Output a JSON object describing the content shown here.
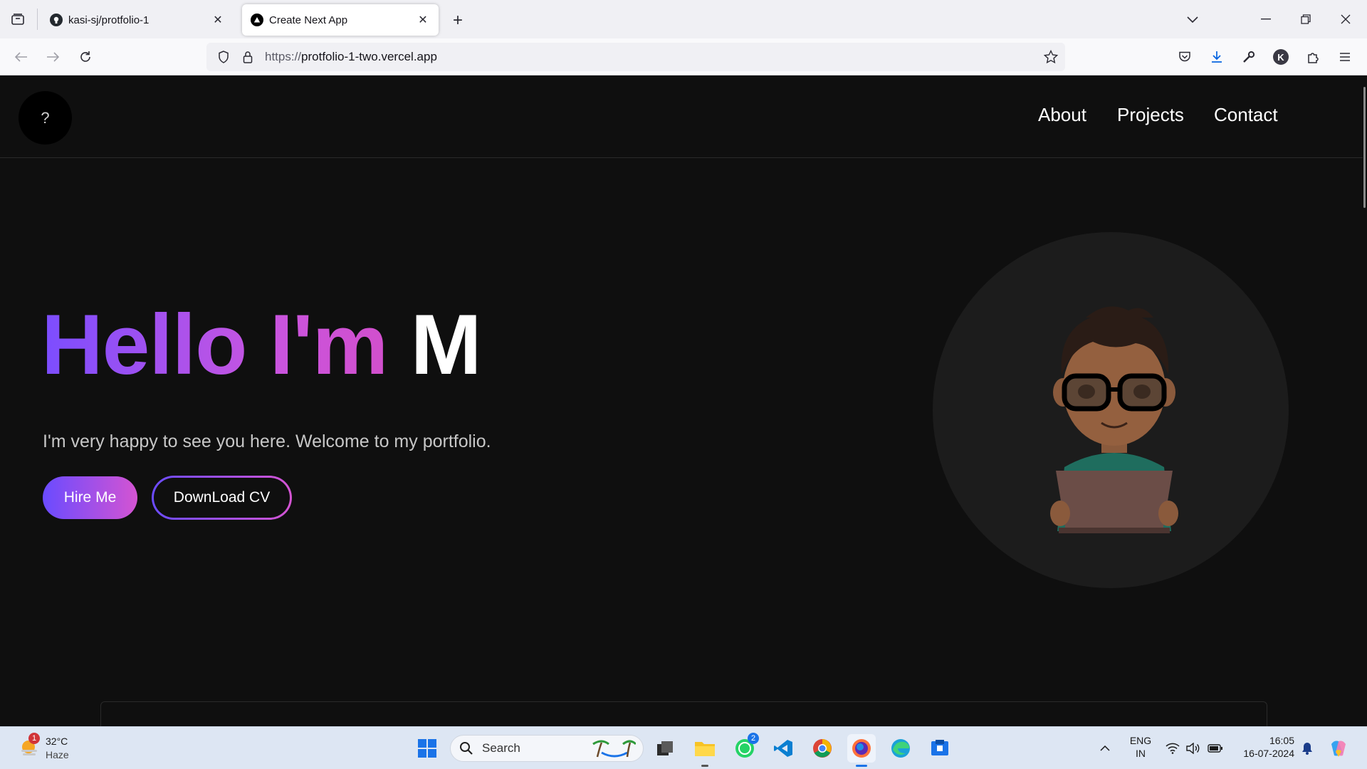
{
  "browser": {
    "tabs": [
      {
        "title": "kasi-sj/protfolio-1",
        "icon": "github-icon",
        "active": false
      },
      {
        "title": "Create Next App",
        "icon": "vercel-icon",
        "active": true
      }
    ],
    "url_scheme": "https://",
    "url_host": "protfolio-1-two.vercel.app",
    "toolbar_icons": [
      "back-icon",
      "forward-icon",
      "reload-icon",
      "shield-icon",
      "lock-icon",
      "bookmark-star-icon",
      "pocket-icon",
      "download-icon",
      "wrench-icon",
      "account-icon",
      "extensions-icon",
      "menu-icon"
    ],
    "account_letter": "K"
  },
  "site": {
    "logo_text": "?",
    "nav": {
      "about": "About",
      "projects": "Projects",
      "contact": "Contact"
    },
    "hero": {
      "title_gradient": "Hello I'm ",
      "title_name": "M",
      "subtitle": "I'm very happy to see you here. Welcome to my portfolio.",
      "hire_label": "Hire Me",
      "cv_label": "DownLoad CV"
    },
    "colors": {
      "gradient_start": "#6a4bff",
      "gradient_end": "#d454d2",
      "background": "#0f0f0f"
    }
  },
  "taskbar": {
    "weather": {
      "temp": "32°C",
      "condition": "Haze",
      "badge": "1"
    },
    "search_placeholder": "Search",
    "whatsapp_badge": "2",
    "lang": {
      "line1": "ENG",
      "line2": "IN"
    },
    "clock": {
      "time": "16:05",
      "date": "16-07-2024"
    }
  }
}
